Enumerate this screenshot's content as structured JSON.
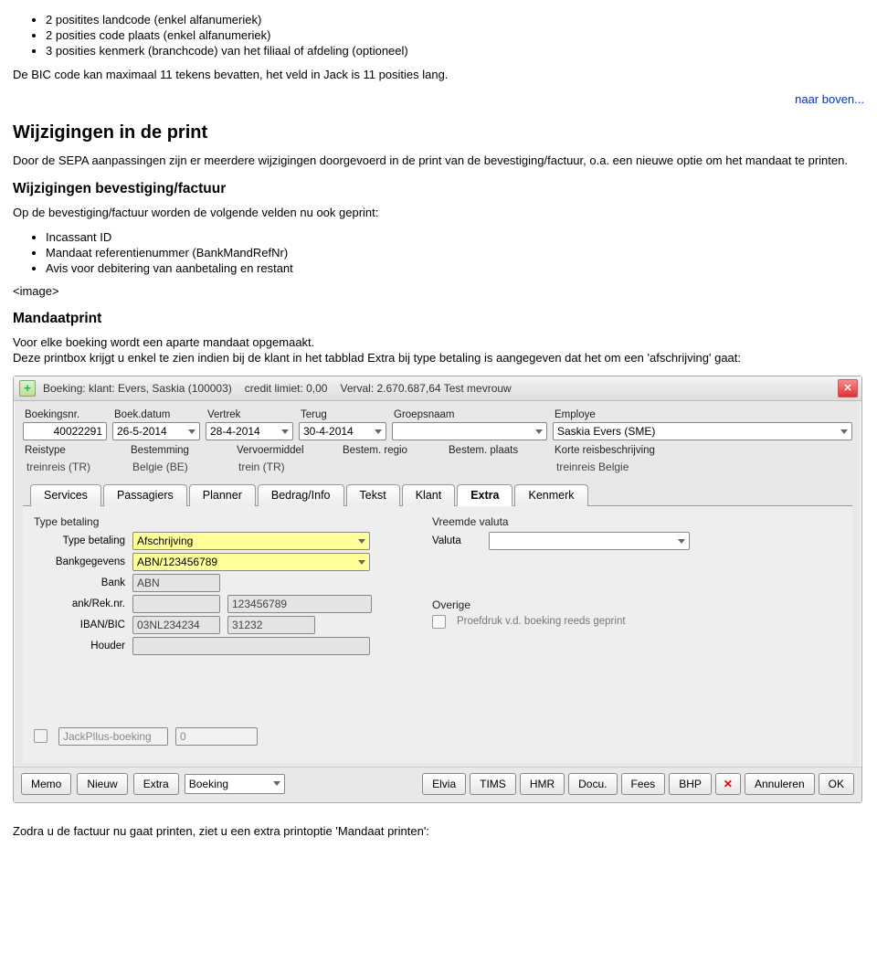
{
  "doc": {
    "bullets1": [
      "2 positites landcode (enkel alfanumeriek)",
      "2 posities code plaats (enkel alfanumeriek)",
      "3 posities kenmerk (branchcode) van het filiaal of afdeling (optioneel)"
    ],
    "bic_note": "De BIC code kan maximaal 11 tekens bevatten, het veld in Jack is 11 posities lang.",
    "naar_boven": "naar boven...",
    "h2": "Wijzigingen in de print",
    "p2": "Door de SEPA aanpassingen zijn er meerdere wijzigingen doorgevoerd in de print van de bevestiging/factuur, o.a. een nieuwe optie om het mandaat te printen.",
    "h3a": "Wijzigingen bevestiging/factuur",
    "p3": "Op de bevestiging/factuur worden de volgende velden nu ook geprint:",
    "bullets2": [
      "Incassant ID",
      "Mandaat referentienummer (BankMandRefNr)",
      "Avis voor debitering van aanbetaling en restant"
    ],
    "image_ph": "<image>",
    "h3b": "Mandaatprint",
    "p4a": "Voor elke boeking wordt een aparte mandaat opgemaakt.",
    "p4b": "Deze printbox krijgt u enkel te zien indien bij de klant in het tabblad Extra bij type betaling is aangegeven dat het om een 'afschrijving' gaat:",
    "p5": "Zodra u de factuur nu gaat printen, ziet u een extra printoptie 'Mandaat printen':"
  },
  "window": {
    "title_boeking": "Boeking: klant: Evers, Saskia  (100003)",
    "title_credit": "credit limiet: 0,00",
    "title_verval": "Verval: 2.670.687,64 Test mevrouw",
    "labels": {
      "boekingsnr": "Boekingsnr.",
      "boekdatum": "Boek.datum",
      "vertrek": "Vertrek",
      "terug": "Terug",
      "groepsnaam": "Groepsnaam",
      "employe": "Employe",
      "reistype": "Reistype",
      "bestemming": "Bestemming",
      "vervoermiddel": "Vervoermiddel",
      "bestemregio": "Bestem. regio",
      "bestemplaats": "Bestem. plaats",
      "korte": "Korte reisbeschrijving"
    },
    "values": {
      "boekingsnr": "40022291",
      "boekdatum": "26-5-2014",
      "vertrek": "28-4-2014",
      "terug": "30-4-2014",
      "groepsnaam": "",
      "employe": "Saskia Evers (SME)",
      "reistype": "treinreis (TR)",
      "bestemming": "Belgie (BE)",
      "vervoermiddel": "trein (TR)",
      "bestemregio": "",
      "bestemplaats": "",
      "korte": "treinreis Belgie"
    },
    "tabs": [
      "Services",
      "Passagiers",
      "Planner",
      "Bedrag/Info",
      "Tekst",
      "Klant",
      "Extra",
      "Kenmerk"
    ],
    "active_tab": "Extra",
    "panel": {
      "left_group": "Type betaling",
      "right_group": "Vreemde valuta",
      "type_betaling_lbl": "Type betaling",
      "type_betaling_val": "Afschrijving",
      "bankgegevens_lbl": "Bankgegevens",
      "bankgegevens_val": "ABN/123456789",
      "bank_lbl": "Bank",
      "bank_val": "ABN",
      "reknr_lbl": "ank/Rek.nr.",
      "reknr_val": "123456789",
      "ibanbic_lbl": "IBAN/BIC",
      "iban_val": "03NL234234",
      "bic_val": "31232",
      "houder_lbl": "Houder",
      "houder_val": "",
      "valuta_lbl": "Valuta",
      "valuta_val": "",
      "overige_lbl": "Overige",
      "proef_lbl": "Proefdruk v.d. boeking reeds geprint"
    },
    "bottom": {
      "jackplus": "JackPllus-boeking",
      "zero": "0",
      "left_btns": [
        "Memo",
        "Nieuw",
        "Extra"
      ],
      "boeking_drop": "Boeking",
      "right_btns": [
        "Elvia",
        "TIMS",
        "HMR",
        "Docu.",
        "Fees",
        "BHP"
      ],
      "annuleren": "Annuleren",
      "ok": "OK"
    }
  }
}
